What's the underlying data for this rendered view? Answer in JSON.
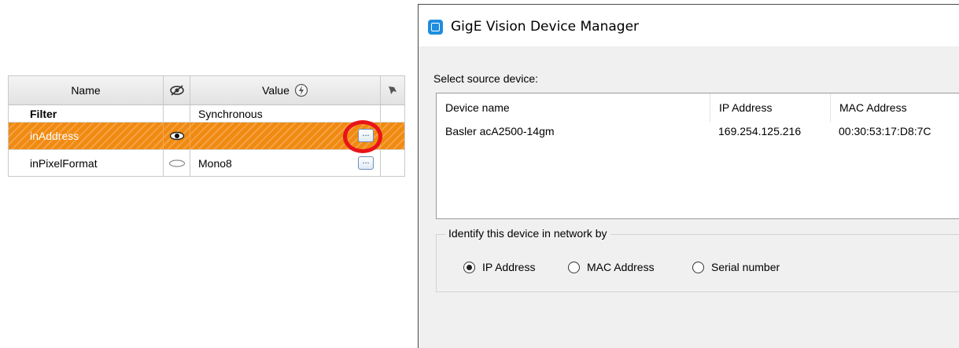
{
  "property_grid": {
    "headers": {
      "name": "Name",
      "value": "Value"
    },
    "rows": [
      {
        "name": "Filter",
        "visibility": "",
        "value": "Synchronous",
        "has_button": false
      },
      {
        "name": "inAddress",
        "visibility": "eye-visible-icon",
        "value": "",
        "has_button": true
      },
      {
        "name": "inPixelFormat",
        "visibility": "eye-hidden-icon",
        "value": "Mono8",
        "has_button": true
      }
    ],
    "button_label": "...",
    "highlight_color": "#e8141a",
    "selected_row_color": "#f08a10"
  },
  "dialog": {
    "title": "GigE Vision Device Manager",
    "select_label": "Select source device:",
    "columns": [
      "Device name",
      "IP Address",
      "MAC Address"
    ],
    "devices": [
      {
        "name": "Basler acA2500-14gm",
        "ip": "169.254.125.216",
        "mac": "00:30:53:17:D8:7C"
      }
    ],
    "identify_group": {
      "legend": "Identify this device in network by",
      "options": [
        {
          "label": "IP Address",
          "checked": true
        },
        {
          "label": "MAC Address",
          "checked": false
        },
        {
          "label": "Serial number",
          "checked": false
        }
      ]
    }
  }
}
